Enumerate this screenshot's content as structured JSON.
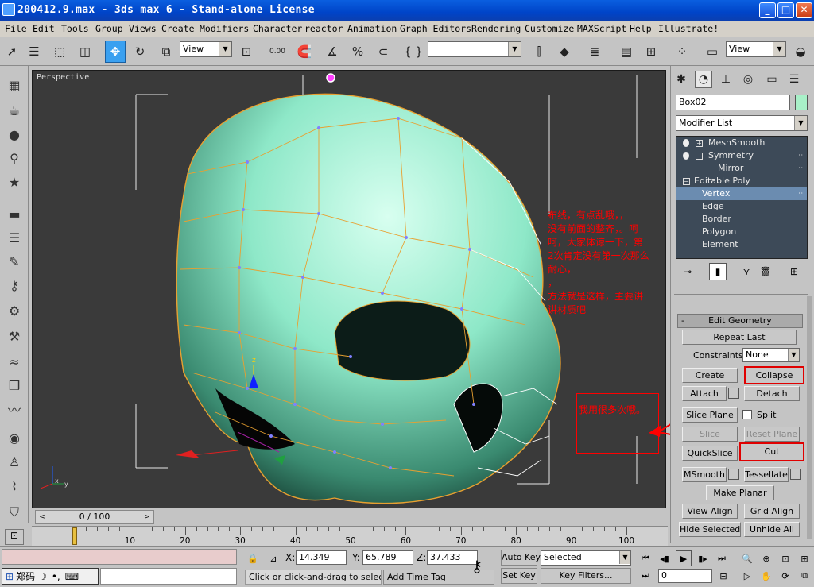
{
  "window": {
    "title": "200412.9.max - 3ds max 6 - Stand-alone License",
    "minimize": "_",
    "maximize": "□",
    "close": "✕"
  },
  "menu": [
    "File",
    "Edit",
    "Tools",
    "Group",
    "Views",
    "Create",
    "Modifiers",
    "Character",
    "reactor",
    "Animation",
    "Graph Editors",
    "Rendering",
    "Customize",
    "MAXScript",
    "Help",
    "Illustrate!"
  ],
  "toolbar": {
    "ref_coord": "View",
    "spinner_snap": "0.00",
    "named_sel": "",
    "view2": "View"
  },
  "viewport": {
    "label": "Perspective",
    "gizmo_z": "z",
    "gizmo_y": "y",
    "gizmo_x": "x"
  },
  "annotations": {
    "main_note": "布线，有点乱哦，，\n没有前面的整齐，。呵\n呵，大家体谅一下，第\n2次肯定没有第一次那么   耐心，\n，\n方法就是这样，主要讲\n讲材质吧",
    "box_note": "我用很多次哦。",
    "colors": {
      "note": "#ff0000"
    }
  },
  "command_panel": {
    "object_name": "Box02",
    "object_color": "#a8f0c8",
    "modifier_list": "Modifier List",
    "stack": [
      {
        "label": "MeshSmooth",
        "indent": 0
      },
      {
        "label": "Symmetry",
        "indent": 0
      },
      {
        "label": "Mirror",
        "indent": 2
      },
      {
        "label": "Editable Poly",
        "indent": 0
      },
      {
        "label": "Vertex",
        "indent": 1,
        "selected": true
      },
      {
        "label": "Edge",
        "indent": 1
      },
      {
        "label": "Border",
        "indent": 1
      },
      {
        "label": "Polygon",
        "indent": 1
      },
      {
        "label": "Element",
        "indent": 1
      }
    ],
    "rollout": {
      "title": "Edit Geometry",
      "collapse_sign": "-",
      "repeat_last": "Repeat Last",
      "constraints_label": "Constraints:",
      "constraints_value": "None",
      "create": "Create",
      "collapse": "Collapse",
      "attach": "Attach",
      "detach": "Detach",
      "slice_plane": "Slice Plane",
      "split": "Split",
      "slice": "Slice",
      "reset_plane": "Reset Plane",
      "quickslice": "QuickSlice",
      "cut": "Cut",
      "msmooth": "MSmooth",
      "tessellate": "Tessellate",
      "make_planar": "Make Planar",
      "view_align": "View Align",
      "grid_align": "Grid Align",
      "hide_selected": "Hide Selected",
      "unhide_all": "Unhide All"
    }
  },
  "timeline": {
    "frame_display": "0 / 100",
    "prev": "<",
    "next": ">",
    "current_frame": 0,
    "total_frames": 100,
    "ticks": [
      0,
      10,
      20,
      30,
      40,
      50,
      60,
      70,
      80,
      90,
      100
    ]
  },
  "status": {
    "x_label": "X:",
    "x": "14.349",
    "y_label": "Y:",
    "y": "65.789",
    "z_label": "Z:",
    "z": "37.433",
    "prompt": "Click or click-and-drag to select obj",
    "add_time_tag": "Add Time Tag",
    "auto_key": "Auto Key",
    "set_key": "Set Key",
    "selected_value": "Selected",
    "key_filters": "Key Filters...",
    "frame_field": "0",
    "ime_text": "郑码"
  }
}
